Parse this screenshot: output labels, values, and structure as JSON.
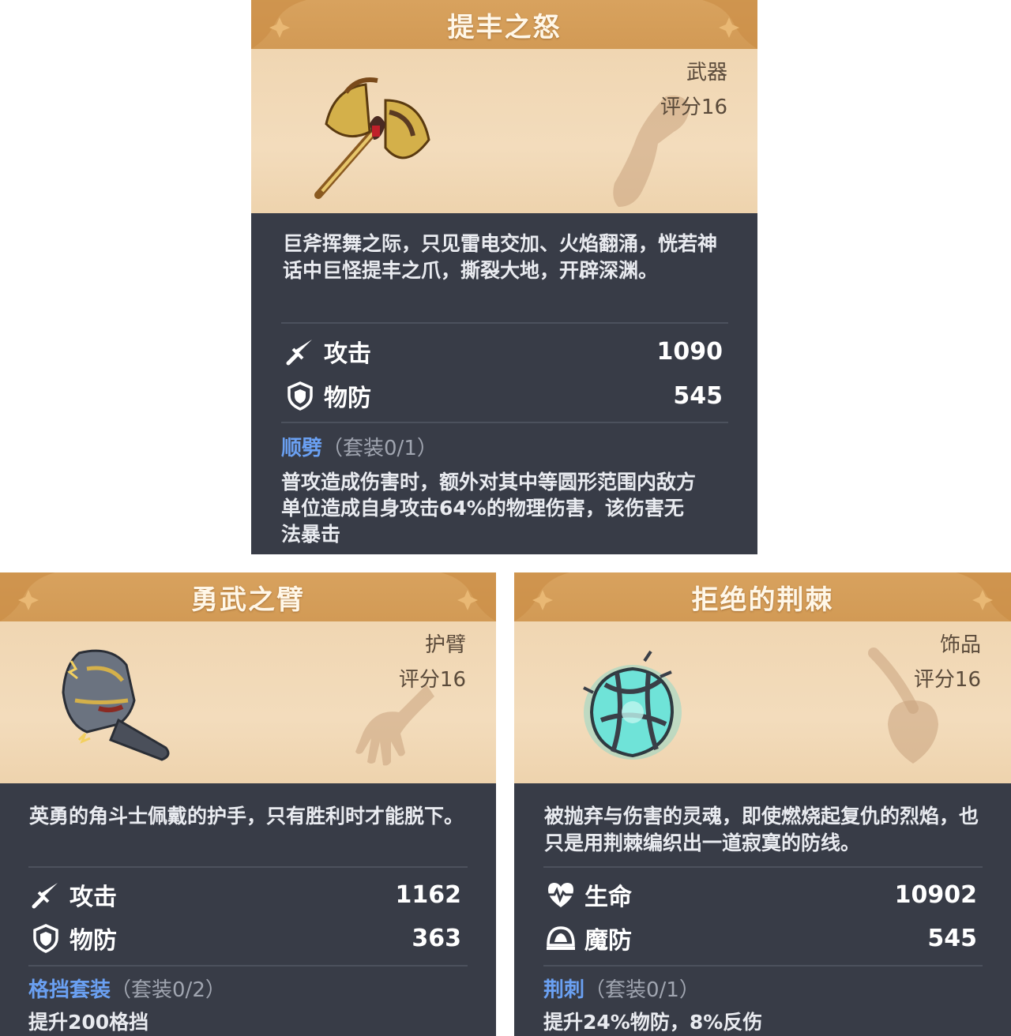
{
  "cards": [
    {
      "title": "提丰之怒",
      "type": "武器",
      "score": "评分16",
      "item_icon": "golden-battle-axe-icon",
      "silhouette_icon": "hand-grip-icon",
      "description": "巨斧挥舞之际，只见雷电交加、火焰翻涌，恍若神话中巨怪提丰之爪，撕裂大地，开辟深渊。",
      "stats": [
        {
          "icon": "sword-icon",
          "label": "攻击",
          "value": "1090"
        },
        {
          "icon": "shield-icon",
          "label": "物防",
          "value": "545"
        }
      ],
      "set_name": "顺劈",
      "set_count": "（套装0/1）",
      "set_effect": "普攻造成伤害时，额外对其中等圆形范围内敌方单位造成自身攻击64%的物理伤害，该伤害无法暴击"
    },
    {
      "title": "勇武之臂",
      "type": "护臂",
      "score": "评分16",
      "item_icon": "armored-gauntlet-icon",
      "silhouette_icon": "hand-icon",
      "description": "英勇的角斗士佩戴的护手，只有胜利时才能脱下。",
      "stats": [
        {
          "icon": "sword-icon",
          "label": "攻击",
          "value": "1162"
        },
        {
          "icon": "shield-icon",
          "label": "物防",
          "value": "363"
        }
      ],
      "set_name": "格挡套装",
      "set_count": "（套装0/2）",
      "set_effect": "提升200格挡"
    },
    {
      "title": "拒绝的荆棘",
      "type": "饰品",
      "score": "评分16",
      "item_icon": "thorn-wrapped-crystal-heart-icon",
      "silhouette_icon": "necklace-pendant-icon",
      "description": "被抛弃与伤害的灵魂，即使燃烧起复仇的烈焰，也只是用荆棘编织出一道寂寞的防线。",
      "stats": [
        {
          "icon": "heartbeat-icon",
          "label": "生命",
          "value": "10902"
        },
        {
          "icon": "magic-defense-icon",
          "label": "魔防",
          "value": "545"
        }
      ],
      "set_name": "荆刺",
      "set_count": "（套装0/1）",
      "set_effect": "提升24%物防，8%反伤"
    }
  ]
}
